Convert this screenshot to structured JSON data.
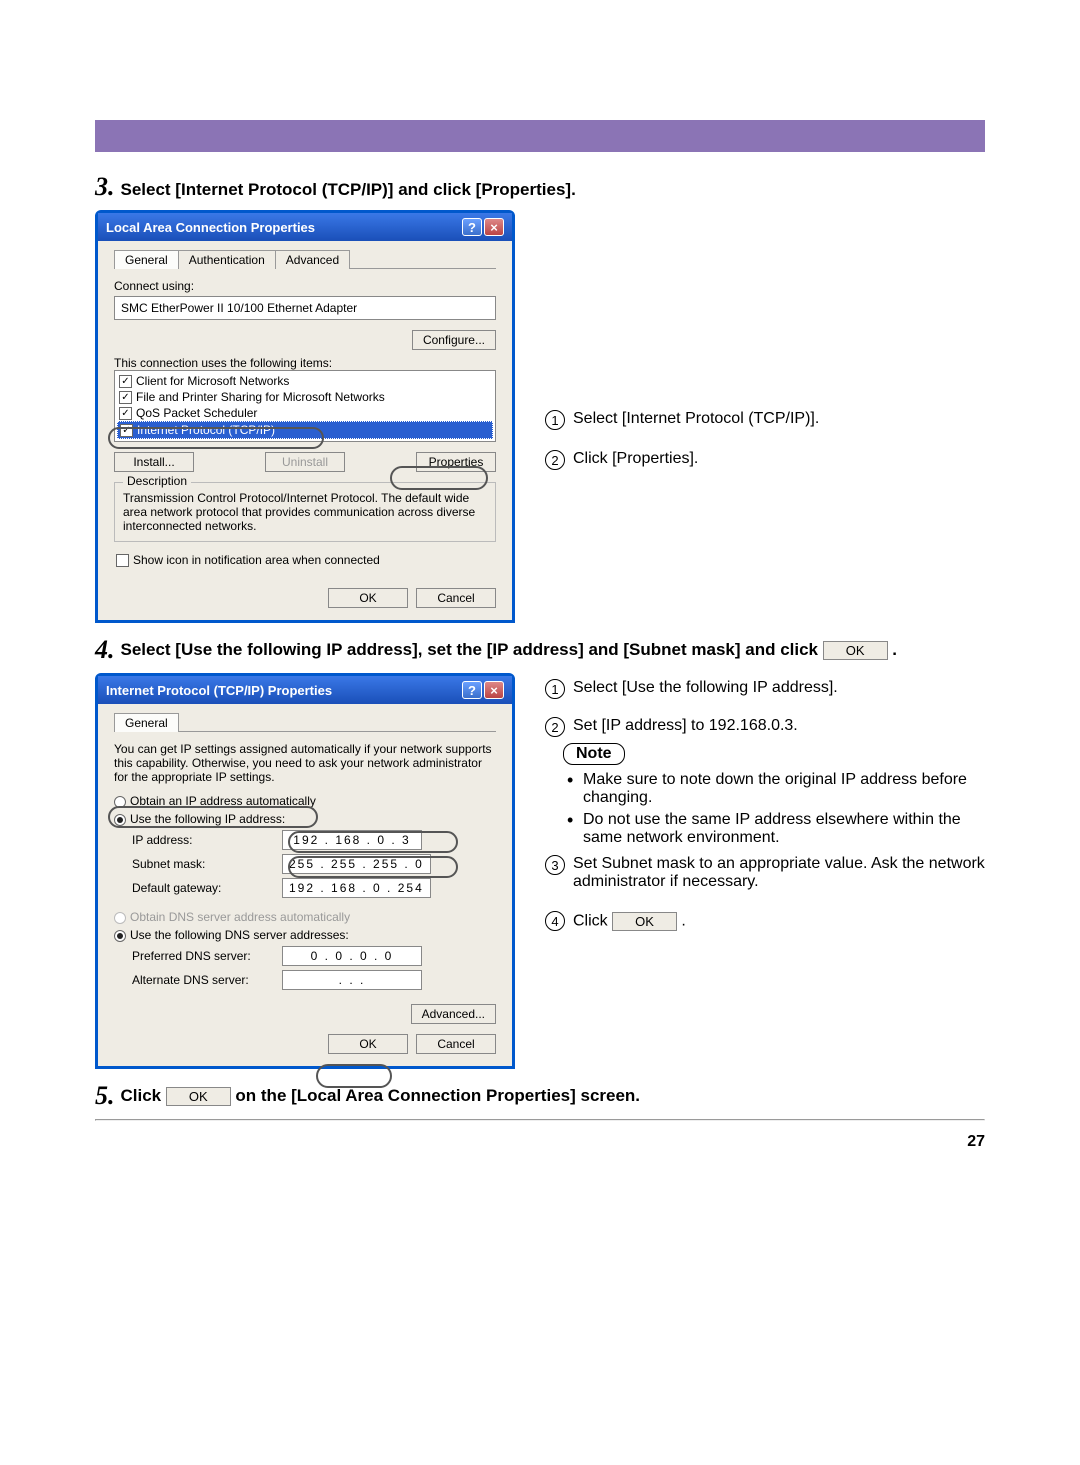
{
  "bar": "",
  "step3": {
    "num": "3.",
    "text": "Select [Internet Protocol (TCP/IP)] and click [Properties]."
  },
  "dlg1": {
    "title": "Local Area Connection Properties",
    "help": "?",
    "close": "×",
    "tabs": {
      "general": "General",
      "auth": "Authentication",
      "adv": "Advanced"
    },
    "connect_using_label": "Connect using:",
    "adapter": "SMC EtherPower II 10/100 Ethernet Adapter",
    "configure_btn": "Configure...",
    "items_label": "This connection uses the following items:",
    "items": [
      "Client for Microsoft Networks",
      "File and Printer Sharing for Microsoft Networks",
      "QoS Packet Scheduler",
      "Internet Protocol (TCP/IP)"
    ],
    "install_btn": "Install...",
    "uninstall_btn": "Uninstall",
    "properties_btn": "Properties",
    "desc_legend": "Description",
    "desc_text": "Transmission Control Protocol/Internet Protocol. The default wide area network protocol that provides communication across diverse interconnected networks.",
    "show_icon": "Show icon in notification area when connected",
    "ok_btn": "OK",
    "cancel_btn": "Cancel"
  },
  "annot1": {
    "n1": "1",
    "t1": "Select [Internet Protocol (TCP/IP)].",
    "n2": "2",
    "t2": "Click [Properties]."
  },
  "step4": {
    "num": "4.",
    "text_a": "Select [Use the following IP address], set the [IP address] and [Subnet mask] and click",
    "ok": "OK",
    "text_b": "."
  },
  "dlg2": {
    "title": "Internet Protocol (TCP/IP) Properties",
    "help": "?",
    "close": "×",
    "tab": "General",
    "intro": "You can get IP settings assigned automatically if your network supports this capability. Otherwise, you need to ask your network administrator for the appropriate IP settings.",
    "r_obtain_ip": "Obtain an IP address automatically",
    "r_use_ip": "Use the following IP address:",
    "ip_label": "IP address:",
    "ip_value": "192 . 168 .   0  .   3",
    "subnet_label": "Subnet mask:",
    "subnet_value": "255 . 255 . 255 .   0",
    "gw_label": "Default gateway:",
    "gw_value": "192 . 168 .   0  . 254",
    "r_obtain_dns": "Obtain DNS server address automatically",
    "r_use_dns": "Use the following DNS server addresses:",
    "pdns_label": "Preferred DNS server:",
    "pdns_value": "0  .   0  .   0  .   0",
    "adns_label": "Alternate DNS server:",
    "adns_value": ".         .         .",
    "advanced_btn": "Advanced...",
    "ok_btn": "OK",
    "cancel_btn": "Cancel"
  },
  "annot2": {
    "n1": "1",
    "t1": "Select [Use the following IP address].",
    "n2": "2",
    "t2": "Set [IP address] to 192.168.0.3.",
    "note_label": "Note",
    "note_b1": "Make sure to note down the original IP address before changing.",
    "note_b2": "Do not use the same IP address elsewhere within the same network environment.",
    "n3": "3",
    "t3": "Set Subnet mask to an appropriate value. Ask the network administrator if necessary.",
    "n4": "4",
    "t4a": "Click",
    "t4_ok": "OK",
    "t4b": "."
  },
  "step5": {
    "num": "5.",
    "text_a": "Click",
    "ok": "OK",
    "text_b": "on the [Local Area Connection Properties] screen."
  },
  "page_number": "27"
}
